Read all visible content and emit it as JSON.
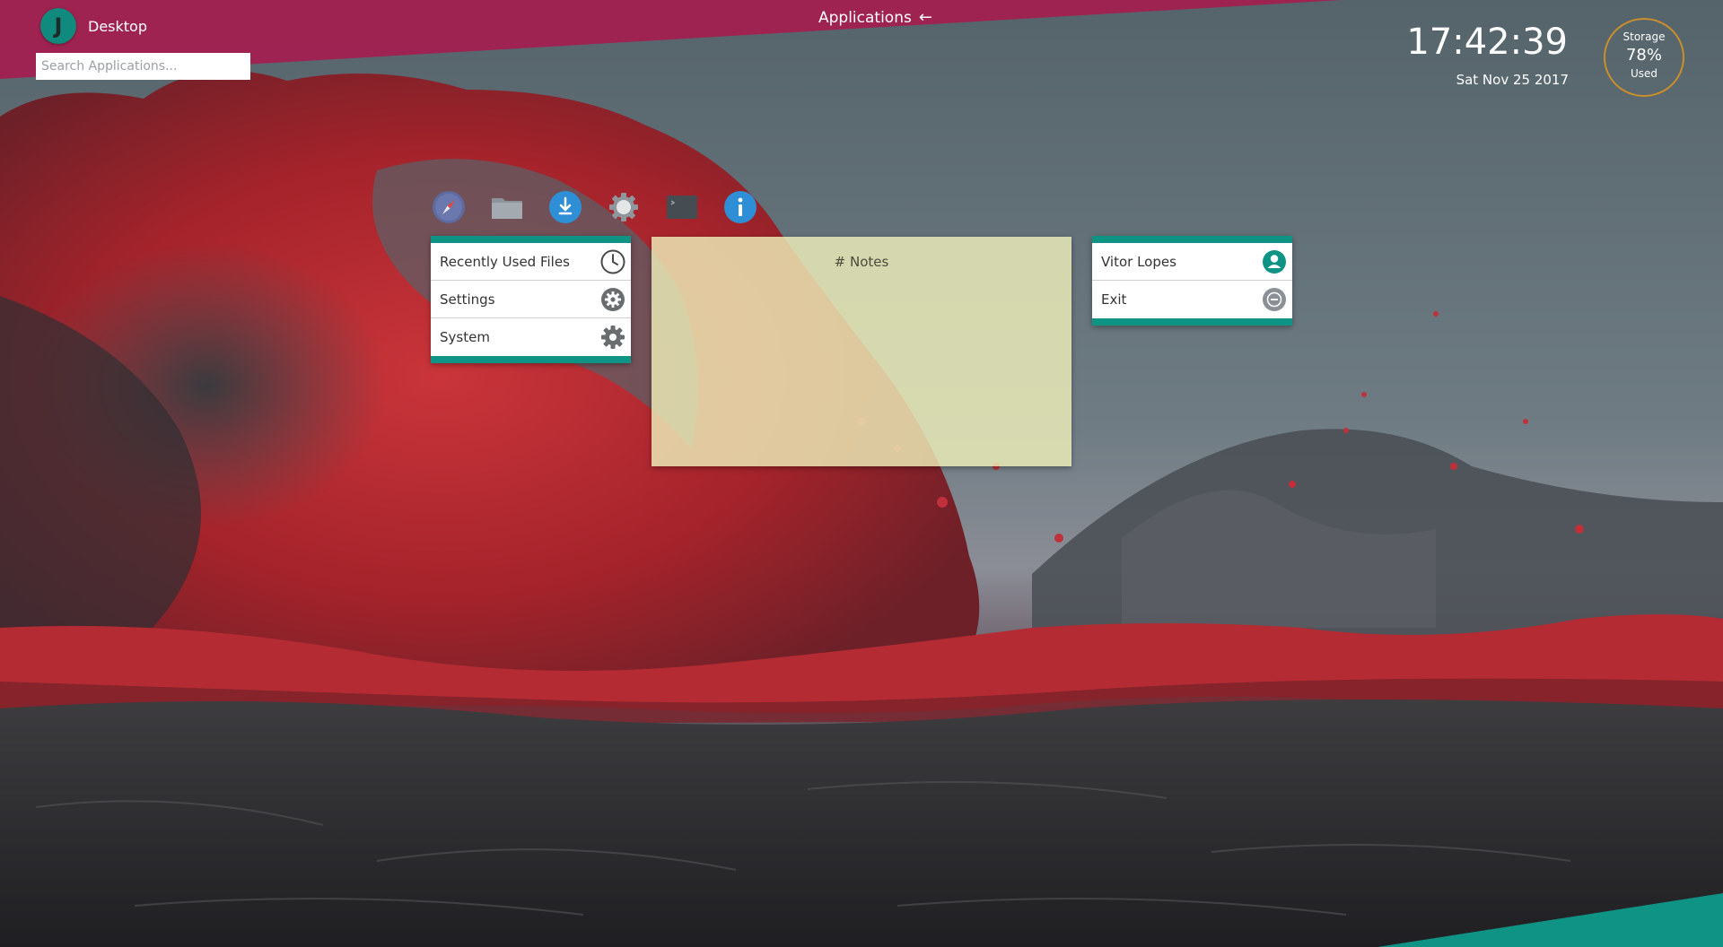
{
  "topbar": {
    "menu_button_letter": "J",
    "desktop_label": "Desktop",
    "search_placeholder": "Search Applications...",
    "applications_label": "Applications",
    "applications_arrow": "←"
  },
  "status": {
    "time": "17:42:39",
    "date": "Sat Nov 25 2017",
    "storage_label": "Storage",
    "storage_value": "78%",
    "storage_used_label": "Used",
    "storage_used_fraction": 0.78
  },
  "dock": [
    {
      "name": "browser-compass-icon"
    },
    {
      "name": "files-folder-icon"
    },
    {
      "name": "download-icon"
    },
    {
      "name": "settings-gear-icon"
    },
    {
      "name": "terminal-icon"
    },
    {
      "name": "info-icon"
    }
  ],
  "left_panel": {
    "items": [
      {
        "label": "Recently Used Files",
        "icon": "clock-icon"
      },
      {
        "label": "Settings",
        "icon": "settings-gear-icon"
      },
      {
        "label": "System",
        "icon": "system-gear-icon"
      }
    ]
  },
  "notes": {
    "text": "# Notes"
  },
  "right_panel": {
    "items": [
      {
        "label": "Vitor Lopes",
        "icon": "user-icon"
      },
      {
        "label": "Exit",
        "icon": "exit-icon"
      }
    ]
  },
  "colors": {
    "accent_teal": "#0e9384",
    "banner_crimson": "#a32050",
    "storage_ring": "#c98f2c",
    "notes_bg": "#eeeeb9"
  }
}
